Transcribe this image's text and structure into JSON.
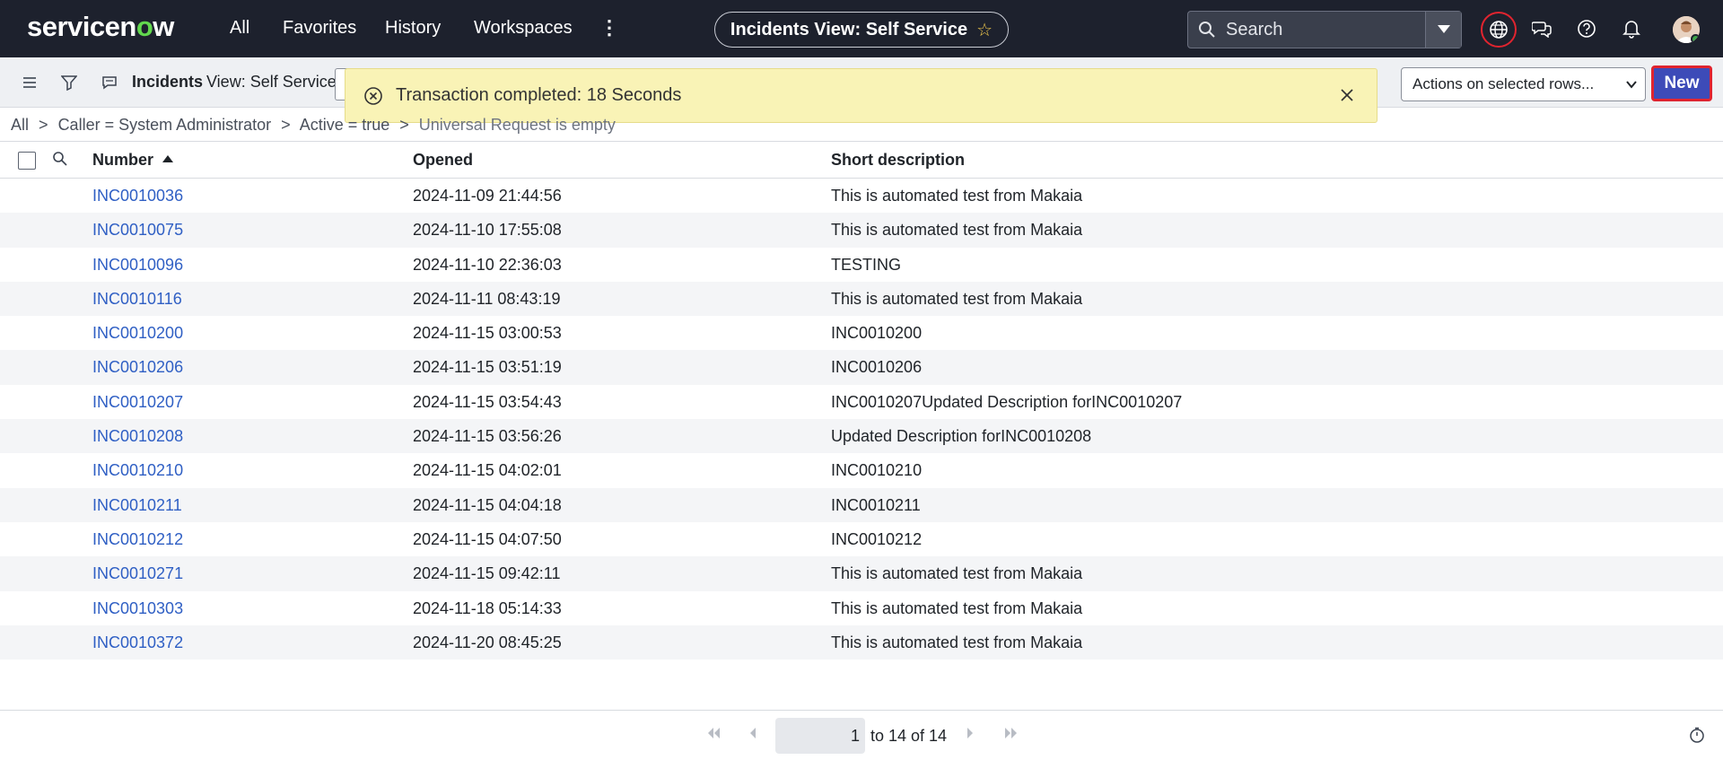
{
  "brand": {
    "logo_pre": "servicen",
    "logo_o": "o",
    "logo_post": "w"
  },
  "nav": {
    "all": "All",
    "favorites": "Favorites",
    "history": "History",
    "workspaces": "Workspaces",
    "more": "⋮"
  },
  "context_pill": {
    "title": "Incidents View: Self Service",
    "star": "☆"
  },
  "search": {
    "placeholder": "Search"
  },
  "list": {
    "title": "Incidents",
    "view": "View: Self Service",
    "actions_select": "Actions on selected rows...",
    "new_label": "New"
  },
  "toast": {
    "message": "Transaction completed: 18 Seconds"
  },
  "breadcrumb": {
    "all": "All",
    "sep": ">",
    "c1": "Caller = System Administrator",
    "c2": "Active = true",
    "c3": "Universal Request is empty"
  },
  "table": {
    "columns": {
      "number": "Number",
      "opened": "Opened",
      "short_description": "Short description"
    },
    "rows": [
      {
        "number": "INC0010036",
        "opened": "2024-11-09 21:44:56",
        "desc": "This is automated test from Makaia"
      },
      {
        "number": "INC0010075",
        "opened": "2024-11-10 17:55:08",
        "desc": "This is automated test from Makaia"
      },
      {
        "number": "INC0010096",
        "opened": "2024-11-10 22:36:03",
        "desc": "TESTING"
      },
      {
        "number": "INC0010116",
        "opened": "2024-11-11 08:43:19",
        "desc": "This is automated test from Makaia"
      },
      {
        "number": "INC0010200",
        "opened": "2024-11-15 03:00:53",
        "desc": "INC0010200"
      },
      {
        "number": "INC0010206",
        "opened": "2024-11-15 03:51:19",
        "desc": "INC0010206"
      },
      {
        "number": "INC0010207",
        "opened": "2024-11-15 03:54:43",
        "desc": "INC0010207Updated Description forINC0010207"
      },
      {
        "number": "INC0010208",
        "opened": "2024-11-15 03:56:26",
        "desc": "Updated Description forINC0010208"
      },
      {
        "number": "INC0010210",
        "opened": "2024-11-15 04:02:01",
        "desc": "INC0010210"
      },
      {
        "number": "INC0010211",
        "opened": "2024-11-15 04:04:18",
        "desc": "INC0010211"
      },
      {
        "number": "INC0010212",
        "opened": "2024-11-15 04:07:50",
        "desc": "INC0010212"
      },
      {
        "number": "INC0010271",
        "opened": "2024-11-15 09:42:11",
        "desc": "This is automated test from Makaia"
      },
      {
        "number": "INC0010303",
        "opened": "2024-11-18 05:14:33",
        "desc": "This is automated test from Makaia"
      },
      {
        "number": "INC0010372",
        "opened": "2024-11-20 08:45:25",
        "desc": "This is automated test from Makaia"
      }
    ]
  },
  "pagination": {
    "current": "1",
    "range_text": "to 14 of 14"
  }
}
